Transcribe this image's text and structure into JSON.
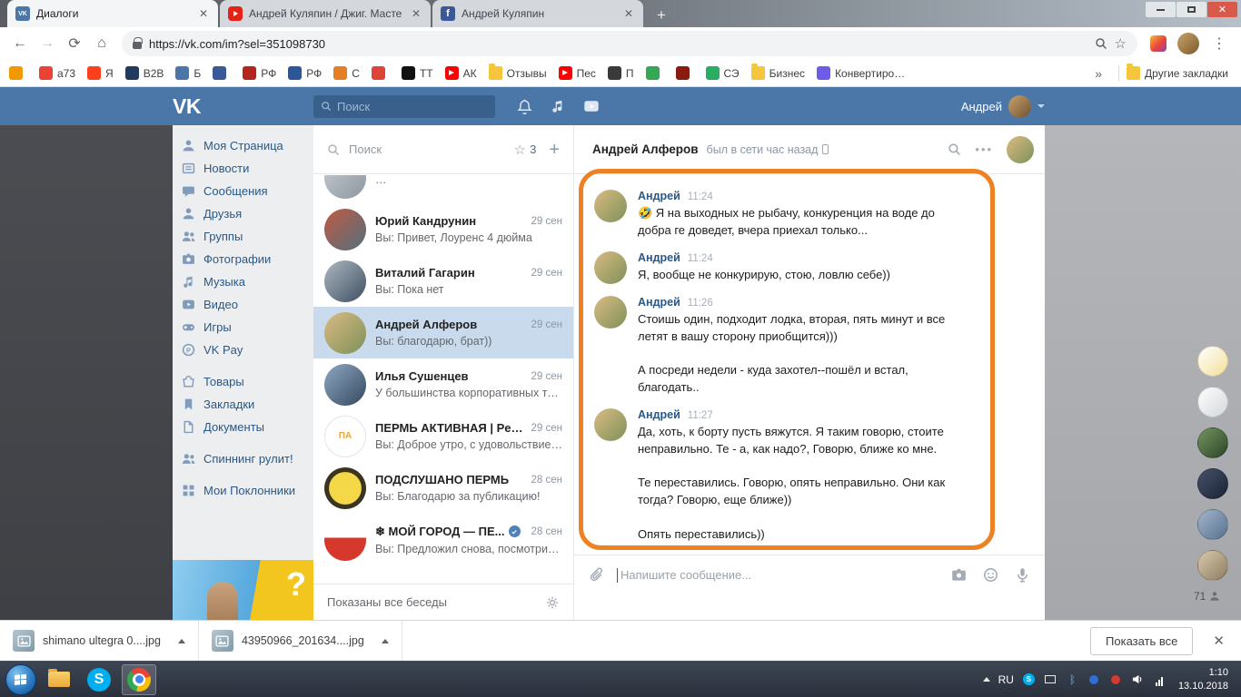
{
  "browser": {
    "tabs": [
      {
        "title": "Диалоги",
        "icon": "vk-favicon",
        "icon_label": "VK"
      },
      {
        "title": "Андрей Куляпин / Джиг. Масте",
        "icon": "youtube-favicon",
        "icon_label": ""
      },
      {
        "title": "Андрей Куляпин",
        "icon": "facebook-favicon",
        "icon_label": "f"
      }
    ],
    "url": "https://vk.com/im?sel=351098730",
    "bookmarks_overflow": "»",
    "other_bookmarks_label": "Другие закладки",
    "bookmarks": [
      {
        "label": "",
        "icon": "apps-bookmark-icon",
        "color": "#f29900"
      },
      {
        "label": "a73",
        "icon": "gmail-bookmark-icon",
        "color": "#ea4335"
      },
      {
        "label": "Я",
        "icon": "yandex-bookmark-icon",
        "color": "#fc3f1d"
      },
      {
        "label": "B2B",
        "icon": "b2b-bookmark-icon",
        "color": "#23395d"
      },
      {
        "label": "Б",
        "icon": "vk-bookmark-icon",
        "color": "#4a76a8"
      },
      {
        "label": "",
        "icon": "facebook-bookmark-icon",
        "color": "#3b5998"
      },
      {
        "label": "РФ",
        "icon": "rf-bookmark-icon",
        "color": "#b3261e"
      },
      {
        "label": "РФ",
        "icon": "rf2-bookmark-icon",
        "color": "#2b579a"
      },
      {
        "label": "С",
        "icon": "s-bookmark-icon",
        "color": "#e57f25"
      },
      {
        "label": "",
        "icon": "gplus-bookmark-icon",
        "color": "#db4437"
      },
      {
        "label": "TT",
        "icon": "tt-bookmark-icon",
        "color": "#111111"
      },
      {
        "label": "АК",
        "icon": "youtube-bookmark-icon",
        "color": "#ff0000"
      },
      {
        "label": "Отзывы",
        "icon": "folder-bookmark-icon",
        "color": "#f5c63c"
      },
      {
        "label": "Пес",
        "icon": "youtube-bookmark-icon",
        "color": "#ff0000"
      },
      {
        "label": "П",
        "icon": "p-bookmark-icon",
        "color": "#3a3a3a"
      },
      {
        "label": "",
        "icon": "green-bookmark-icon",
        "color": "#34a853"
      },
      {
        "label": "",
        "icon": "red-bookmark-icon",
        "color": "#8b1a10"
      },
      {
        "label": "СЭ",
        "icon": "se-bookmark-icon",
        "color": "#27ae60"
      },
      {
        "label": "Бизнес",
        "icon": "folder-bookmark-icon",
        "color": "#f5c63c"
      },
      {
        "label": "Конвертировать изо",
        "icon": "converter-bookmark-icon",
        "color": "#6c5ce7"
      }
    ]
  },
  "vk_header": {
    "logo": "VK",
    "search_placeholder": "Поиск",
    "user_name": "Андрей"
  },
  "sidebar": {
    "items": [
      {
        "label": "Моя Страница",
        "icon": "profile-icon"
      },
      {
        "label": "Новости",
        "icon": "news-icon"
      },
      {
        "label": "Сообщения",
        "icon": "messages-icon"
      },
      {
        "label": "Друзья",
        "icon": "friends-icon"
      },
      {
        "label": "Группы",
        "icon": "groups-icon"
      },
      {
        "label": "Фотографии",
        "icon": "photos-icon"
      },
      {
        "label": "Музыка",
        "icon": "music-icon"
      },
      {
        "label": "Видео",
        "icon": "video-icon"
      },
      {
        "label": "Игры",
        "icon": "games-icon"
      },
      {
        "label": "VK Pay",
        "icon": "vkpay-icon"
      },
      {
        "label": "Товары",
        "icon": "market-icon"
      },
      {
        "label": "Закладки",
        "icon": "bookmarks-icon"
      },
      {
        "label": "Документы",
        "icon": "documents-icon"
      },
      {
        "label": "Спиннинг рулит!",
        "icon": "community-icon"
      },
      {
        "label": "Мои Поклонники",
        "icon": "app-icon"
      }
    ],
    "ad_symbol": "?"
  },
  "dialogs": {
    "search_placeholder": "Поиск",
    "important_count": "3",
    "partial_preview": "…",
    "items": [
      {
        "name": "Юрий Кандрунин",
        "date": "29 сен",
        "preview": "Вы: Привет, Лоуренс 4 дюйма"
      },
      {
        "name": "Виталий Гагарин",
        "date": "29 сен",
        "preview": "Вы: Пока нет"
      },
      {
        "name": "Андрей Алферов",
        "date": "29 сен",
        "preview": "Вы: благодарю, брат))"
      },
      {
        "name": "Илья Сушенцев",
        "date": "29 сен",
        "preview": "У большинства корпоративных тари..."
      },
      {
        "name": "ПЕРМЬ АКТИВНАЯ | Perm...",
        "date": "29 сен",
        "preview": "Вы: Доброе утро, с удовольствием))",
        "avatar_text": "ПА"
      },
      {
        "name": "ПОДСЛУШАНО ПЕРМЬ",
        "date": "28 сен",
        "preview": "Вы: Благодарю за публикацию!"
      },
      {
        "name": "❄ МОЙ ГОРОД — ПЕ...",
        "date": "28 сен",
        "preview": "Вы: Предложил снова, посмотрите, б..."
      }
    ],
    "footer": "Показаны все беседы"
  },
  "chat": {
    "peer_name": "Андрей Алферов",
    "status": "был в сети час назад",
    "messages": [
      {
        "author": "Андрей",
        "time": "11:24",
        "text": "🤣 Я на выходных не рыбачу, конкуренция на воде до добра ге доведет, вчера приехал только..."
      },
      {
        "author": "Андрей",
        "time": "11:24",
        "text": "Я, вообще не конкурирую, стою, ловлю себе))"
      },
      {
        "author": "Андрей",
        "time": "11:26",
        "text": "Стоишь один, подходит лодка, вторая, пять минут и все летят в вашу сторону приобщится)))\n\nА посреди недели - куда захотел--пошёл и встал, благодать.."
      },
      {
        "author": "Андрей",
        "time": "11:27",
        "text": "Да, хоть, к борту пусть вяжутся. Я таким говорю, стоите неправильно. Те - а, как надо?, Говорю, ближе ко мне.\n\nТе переставились. Говорю, опять неправильно. Они как тогда? Говорю, еще ближе))\n\nОпять переставились))\n\nСнова говорю, не так стоите. Те, а как все-таки надо????\n\nЯ им, да, вы прямо к моему борту вяжитесь - самое то будет))))))))))"
      }
    ],
    "input_placeholder": "Напишите сообщение..."
  },
  "friends_rail": {
    "online_count": "71"
  },
  "downloads": {
    "items": [
      {
        "filename": "shimano ultegra 0....jpg"
      },
      {
        "filename": "43950966_201634....jpg"
      }
    ],
    "show_all_label": "Показать все"
  },
  "taskbar": {
    "language": "RU",
    "time": "1:10",
    "date": "13.10.2018"
  },
  "colors": {
    "vk_blue": "#4a76a8",
    "annotation_orange": "#ee8222",
    "selected_dialog": "#c8daeb"
  }
}
